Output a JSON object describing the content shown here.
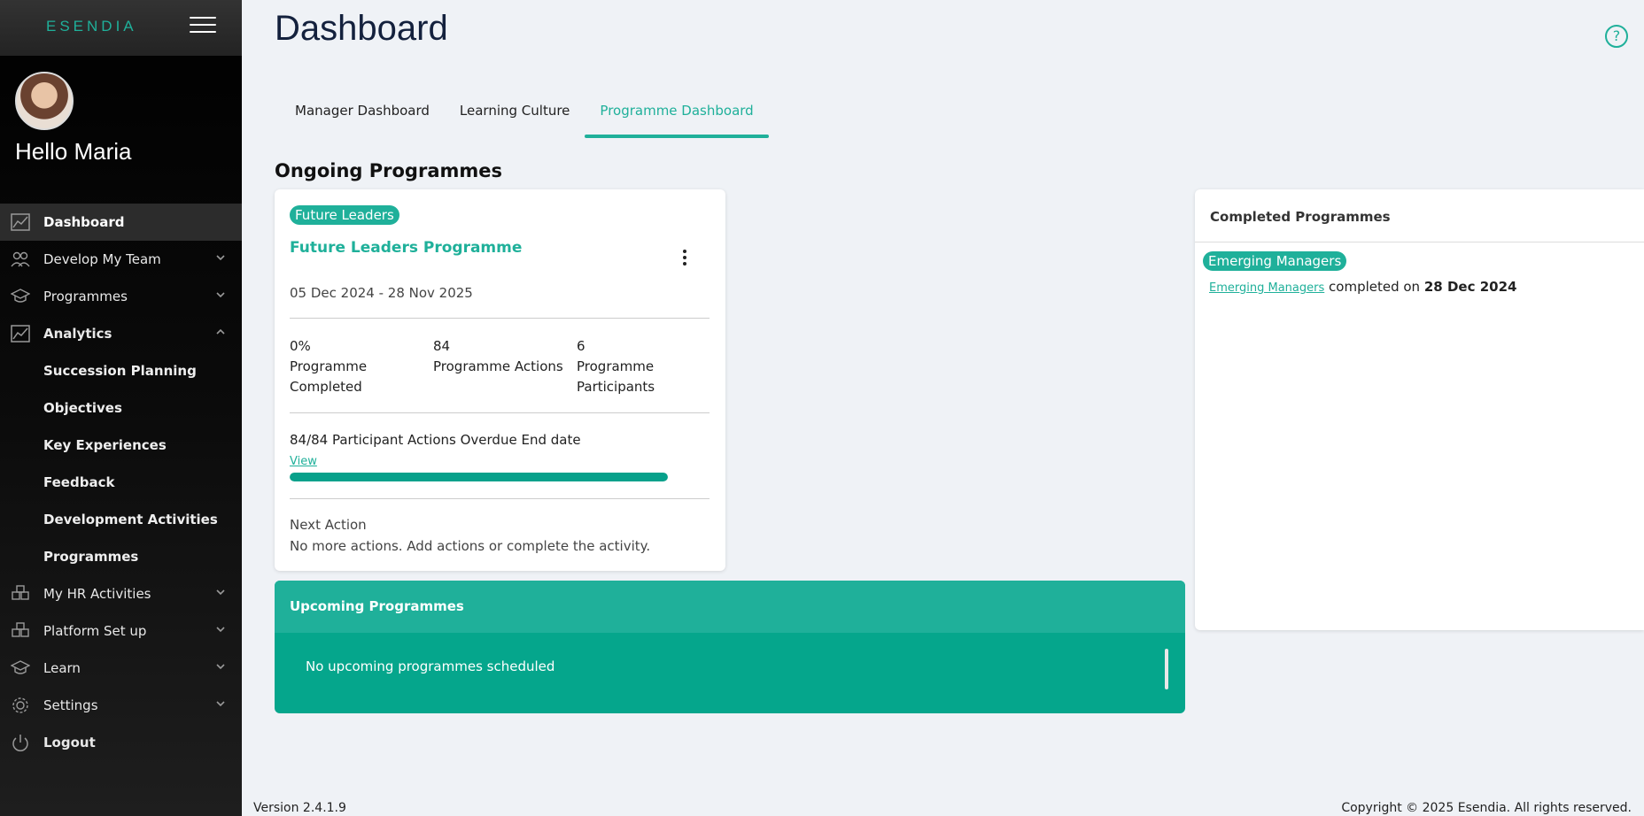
{
  "app": {
    "logo": "ESENDIA",
    "greeting": "Hello Maria"
  },
  "sidebar": {
    "items": [
      {
        "label": "Dashboard",
        "icon": "chart-line-icon",
        "active": true
      },
      {
        "label": "Develop My Team",
        "icon": "team-icon",
        "expandable": true
      },
      {
        "label": "Programmes",
        "icon": "graduation-cap-icon",
        "expandable": true
      },
      {
        "label": "Analytics",
        "icon": "chart-line-icon",
        "expanded": true
      }
    ],
    "analytics_sub": [
      "Succession Planning",
      "Objectives",
      "Key Experiences",
      "Feedback",
      "Development Activities",
      "Programmes"
    ],
    "items_after": [
      {
        "label": "My HR Activities",
        "icon": "boxes-icon"
      },
      {
        "label": "Platform Set up",
        "icon": "boxes-icon"
      },
      {
        "label": "Learn",
        "icon": "graduation-cap-icon"
      },
      {
        "label": "Settings",
        "icon": "gear-icon"
      }
    ],
    "logout": "Logout"
  },
  "header": {
    "title": "Dashboard"
  },
  "tabs": [
    {
      "label": "Manager Dashboard"
    },
    {
      "label": "Learning Culture"
    },
    {
      "label": "Programme Dashboard",
      "active": true
    }
  ],
  "ongoing": {
    "title": "Ongoing Programmes",
    "badge": "Future Leaders",
    "name": "Future Leaders Programme",
    "dates": "05 Dec 2024 - 28 Nov 2025",
    "stats": [
      {
        "value": "0%",
        "label": "Programme Completed"
      },
      {
        "value": "84",
        "label": "Programme Actions"
      },
      {
        "value": "6",
        "label": "Programme Participants"
      }
    ],
    "overdue": "84/84 Participant Actions Overdue End date",
    "view": "View",
    "progress_percent": 100,
    "next_label": "Next Action",
    "next_text": "No more actions. Add actions or complete the activity."
  },
  "upcoming": {
    "title": "Upcoming Programmes",
    "empty": "No upcoming programmes scheduled"
  },
  "completed": {
    "title": "Completed Programmes",
    "badge": "Emerging Managers",
    "link": "Emerging Managers",
    "text": "completed on",
    "date": "28 Dec 2024"
  },
  "footer": {
    "version": "Version 2.4.1.9",
    "copyright": "Copyright © 2025 Esendia. All rights reserved."
  },
  "colors": {
    "accent": "#1fb09a",
    "accent_dark": "#07a18b",
    "title": "#14213d"
  }
}
